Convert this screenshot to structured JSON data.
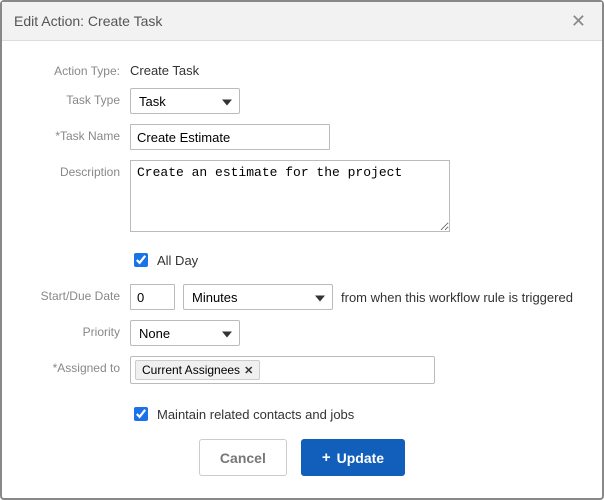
{
  "header": {
    "title": "Edit Action: Create Task"
  },
  "labels": {
    "action_type": "Action Type:",
    "task_type": "Task Type",
    "task_name": "*Task Name",
    "description": "Description",
    "start_due": "Start/Due Date",
    "priority": "Priority",
    "assigned_to": "*Assigned to"
  },
  "values": {
    "action_type": "Create Task",
    "task_type": "Task",
    "task_name": "Create Estimate",
    "description": "Create an estimate for the project",
    "all_day_label": "All Day",
    "all_day_checked": true,
    "start_offset": "0",
    "start_unit": "Minutes",
    "start_suffix": "from when this workflow rule is triggered",
    "priority": "None",
    "assignee_tag": "Current Assignees",
    "maintain_label": "Maintain related contacts and jobs",
    "maintain_checked": true
  },
  "footer": {
    "cancel": "Cancel",
    "update": "Update"
  }
}
